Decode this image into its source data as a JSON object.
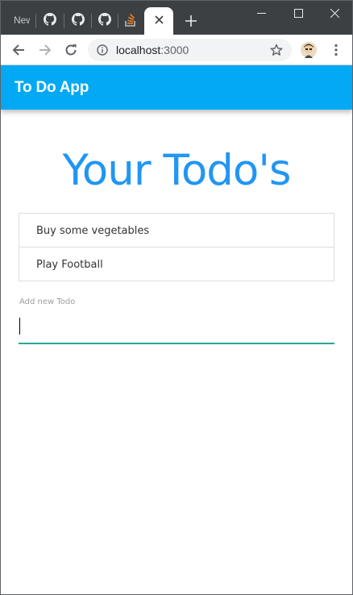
{
  "browser": {
    "tabs": [
      {
        "label": "New",
        "icon": "partial-tab"
      },
      {
        "icon": "github-icon"
      },
      {
        "icon": "github-icon"
      },
      {
        "icon": "github-icon"
      },
      {
        "icon": "stack-overflow-icon"
      }
    ],
    "active_tab_close": "✕",
    "new_tab": "+",
    "url_host": "localhost",
    "url_port": ":3000"
  },
  "app": {
    "appbar_title": "To Do App",
    "page_title": "Your Todo's",
    "todos": [
      {
        "text": "Buy some vegetables"
      },
      {
        "text": "Play Football"
      }
    ],
    "new_todo_label": "Add new Todo",
    "new_todo_value": ""
  },
  "colors": {
    "appbar": "#03a9f4",
    "title": "#2196f3",
    "input_underline": "#26a69a",
    "tabstrip": "#3c4043"
  }
}
